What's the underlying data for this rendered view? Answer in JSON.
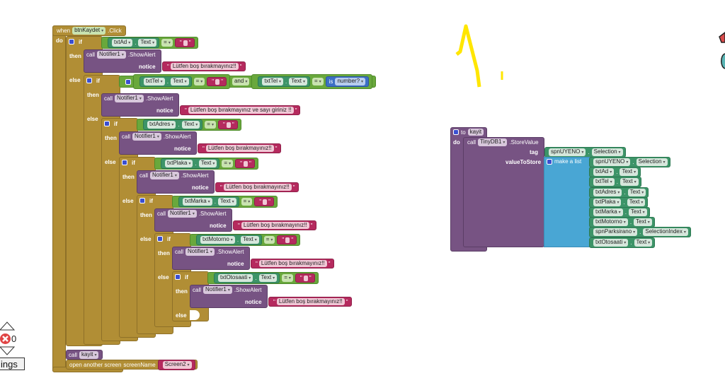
{
  "labels": {
    "if": "if",
    "then": "then",
    "else": "else",
    "do": "do",
    "call": "call",
    "notice": "notice",
    "notifier": "Notifier1",
    "show_alert": ".ShowAlert",
    "and": "and",
    "is": "is",
    "number": "number?"
  },
  "event": {
    "when": "when",
    "component": "btnKaydet",
    "event": ".Click"
  },
  "if_chain": [
    {
      "component": "txtAd",
      "property": "Text",
      "op": "=",
      "message": "Lütfen boş bırakmayınız!!"
    },
    {
      "component": "txtTel",
      "property": "Text",
      "op": "=",
      "second_component": "txtTel",
      "second_property": "Text",
      "second_op": "=",
      "message": "Lütfen boş bırakmayınız ve sayı giriniz !!"
    },
    {
      "component": "txtAdres",
      "property": "Text",
      "op": "=",
      "message": "Lütfen boş bırakmayınız!!"
    },
    {
      "component": "txtPlaka",
      "property": "Text",
      "op": "=",
      "message": "Lütfen boş bırakmayınız!!"
    },
    {
      "component": "txtMarka",
      "property": "Text",
      "op": "=",
      "message": "Lütfen boş bırakmayınız!!"
    },
    {
      "component": "txtMotorno",
      "property": "Text",
      "op": "=",
      "message": "Lütfen boş bırakmayınız!!"
    },
    {
      "component": "txtOtosaati",
      "property": "Text",
      "op": "=",
      "message": "Lütfen boş bırakmayınız!!"
    }
  ],
  "final_call": {
    "call": "call",
    "procedure": "kayit"
  },
  "open_screen": {
    "label": "open another screen",
    "param": "screenName",
    "value": "Screen2"
  },
  "procedure": {
    "to": "to",
    "name": "kayit",
    "do": "do",
    "call": "call",
    "component": "TinyDB1",
    "method": ".StoreValue",
    "tag_label": "tag",
    "value_label": "valueToStore",
    "tag": {
      "component": "spnUYENO",
      "property": "Selection"
    },
    "make_list": "make a list",
    "items": [
      {
        "component": "spnUYENO",
        "property": "Selection"
      },
      {
        "component": "txtAd",
        "property": "Text"
      },
      {
        "component": "txtTel",
        "property": "Text"
      },
      {
        "component": "txtAdres",
        "property": "Text"
      },
      {
        "component": "txtPlaka",
        "property": "Text"
      },
      {
        "component": "txtMarka",
        "property": "Text"
      },
      {
        "component": "txtMotorno",
        "property": "Text"
      },
      {
        "component": "spnParksirano",
        "property": "SelectionIndex"
      },
      {
        "component": "txtOtosaati",
        "property": "Text"
      }
    ]
  },
  "warnings": {
    "error_count": "0",
    "settings_label": "ings"
  },
  "colors": {
    "control": "#b18e35",
    "procedure": "#775383",
    "logic": "#69a83c",
    "component": "#3d9468",
    "text": "#b52a5e",
    "list": "#49a6d4",
    "annotation": "#ffe600"
  }
}
